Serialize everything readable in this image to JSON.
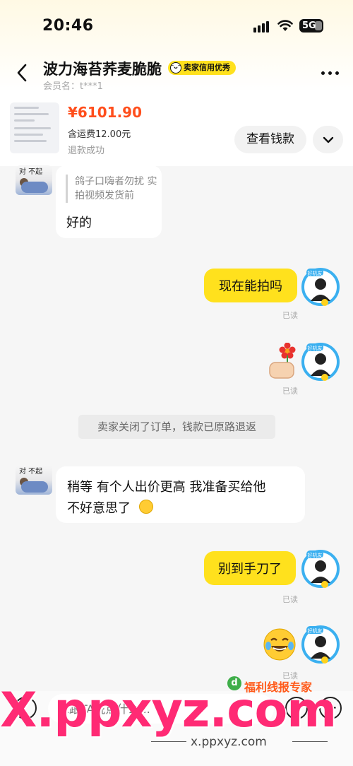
{
  "status_bar": {
    "time": "20:46",
    "network": "5G"
  },
  "header": {
    "title": "波力海苔荞麦脆脆",
    "badge": "卖家信用优秀",
    "member": "会员名：t***1"
  },
  "order": {
    "price": "¥6101.90",
    "shipping": "含运费12.00元",
    "status": "退款成功",
    "view_money_button": "查看钱款"
  },
  "messages": {
    "quote": "鸽子口嗨者勿扰 实拍视频发货前",
    "m1": "好的",
    "m2": "现在能拍吗",
    "m2_read": "已读",
    "m3_read": "已读",
    "system": "卖家关闭了订单，钱款已原路退返",
    "m4_line1": "稍等 有个人出价更高 我准备买给他",
    "m4_line2": "不好意思了",
    "m5": "别到手刀了",
    "m5_read": "已读",
    "m6_read": "已读"
  },
  "avatar": {
    "seller_caption": "对 不起",
    "me_caption": "好机友"
  },
  "input": {
    "placeholder": "想跟TA说点什么..."
  },
  "watermark": {
    "big": "X.ppxyz.com",
    "small": "x.ppxyz.com",
    "brand": "福利线报专家",
    "brand_icon": "d"
  }
}
